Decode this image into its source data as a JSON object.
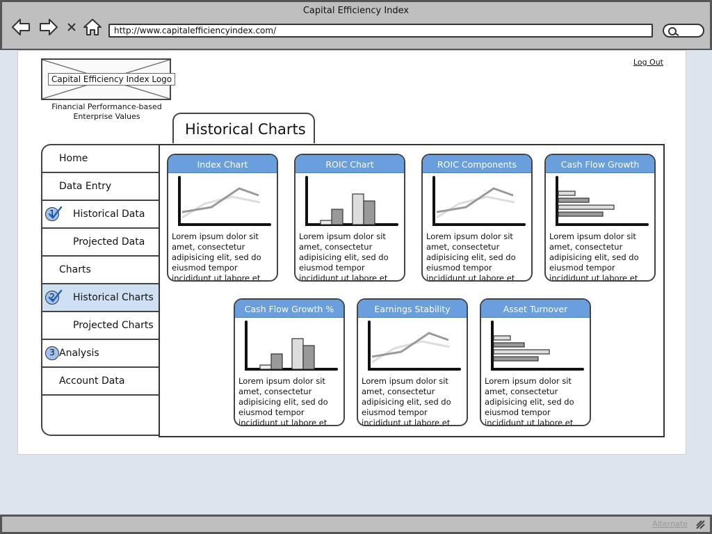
{
  "window": {
    "title": "Capital Efficiency Index"
  },
  "address_bar": {
    "url": "http://www.capitalefficiencyindex.com/"
  },
  "header": {
    "logo_label": "Capital Efficiency Index Logo",
    "tagline_line1": "Financial Performance-based",
    "tagline_line2": "Enterprise Values",
    "logout_label": "Log Out"
  },
  "page_title": "Historical Charts",
  "sidebar": {
    "items": [
      {
        "label": "Home",
        "badge": ""
      },
      {
        "label": "Data Entry",
        "badge": ""
      },
      {
        "label": "Historical Data",
        "badge": "1"
      },
      {
        "label": "Projected Data",
        "badge": ""
      },
      {
        "label": "Charts",
        "badge": ""
      },
      {
        "label": "Historical Charts",
        "badge": "2"
      },
      {
        "label": "Projected Charts",
        "badge": ""
      },
      {
        "label": "Analysis",
        "badge": "3"
      },
      {
        "label": "Account Data",
        "badge": ""
      }
    ]
  },
  "cards": [
    {
      "title": "Index Chart",
      "chart": "line",
      "text": "Lorem ipsum dolor sit amet, consectetur adipisicing elit, sed do eiusmod tempor incididunt ut labore et dolore."
    },
    {
      "title": "ROIC Chart",
      "chart": "bar",
      "text": "Lorem ipsum dolor sit amet, consectetur adipisicing elit, sed do eiusmod tempor incididunt ut labore et dolore."
    },
    {
      "title": "ROIC Components",
      "chart": "line",
      "text": "Lorem ipsum dolor sit amet, consectetur adipisicing elit, sed do eiusmod tempor incididunt ut labore et dolore."
    },
    {
      "title": "Cash Flow Growth",
      "chart": "hbar",
      "text": "Lorem ipsum dolor sit amet, consectetur adipisicing elit, sed do eiusmod tempor incididunt ut labore et dolore."
    },
    {
      "title": "Cash Flow Growth %",
      "chart": "bar",
      "text": "Lorem ipsum dolor sit amet, consectetur adipisicing elit, sed do eiusmod tempor incididunt ut labore et dolore."
    },
    {
      "title": "Earnings Stability",
      "chart": "line",
      "text": "Lorem ipsum dolor sit amet, consectetur adipisicing elit, sed do eiusmod tempor incididunt ut labore et dolore."
    },
    {
      "title": "Asset Turnover",
      "chart": "hbar",
      "text": "Lorem ipsum dolor sit amet, consectetur adipisicing elit, sed do eiusmod tempor incididunt ut labore et dolore."
    }
  ],
  "footer": {
    "alternate_label": "Alternate"
  },
  "colors": {
    "card_header": "#6a9fde",
    "selected_nav": "#cfe0f5",
    "badge": "#9ec3ee",
    "chrome": "#bfbfbf",
    "backdrop": "#dde4ee"
  }
}
